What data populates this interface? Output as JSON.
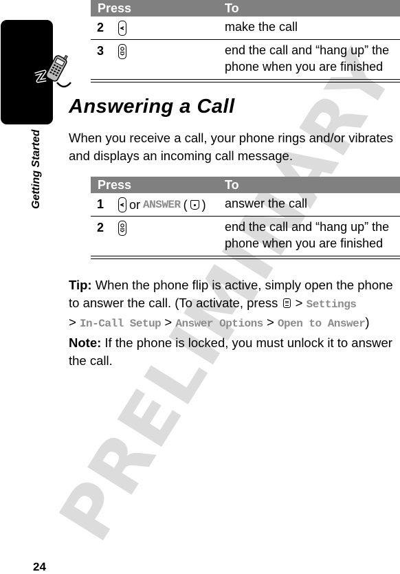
{
  "page": {
    "number": "24",
    "section_label": "Getting Started",
    "watermark": "PRELIMINARY"
  },
  "table_top": {
    "headers": {
      "press": "Press",
      "to": "To"
    },
    "rows": [
      {
        "num": "2",
        "key_icon": "send-key-icon",
        "press_text": "",
        "to": "make the call"
      },
      {
        "num": "3",
        "key_icon": "end-key-icon",
        "press_text": "",
        "to": "end the call and “hang up” the phone when you are finished"
      }
    ]
  },
  "heading": "Answering a Call",
  "intro": "When you receive a call, your phone rings and/or vibrates and displays an incoming call message.",
  "table_answer": {
    "headers": {
      "press": "Press",
      "to": "To"
    },
    "rows": [
      {
        "num": "1",
        "key_icon": "send-key-icon",
        "or_text": "or",
        "softkey_label": "ANSWER",
        "softkey_icon": "center-select-key-icon",
        "to": "answer the call"
      },
      {
        "num": "2",
        "key_icon": "end-key-icon",
        "to": "end the call and “hang up” the phone when you are finished"
      }
    ]
  },
  "tip": {
    "label": "Tip:",
    "text1": "When the phone flip is active, simply open the phone to answer the call. (To activate, press",
    "menu_icon": "menu-key-icon",
    "path": [
      "Settings",
      "In-Call Setup",
      "Answer Options",
      "Open to Answer"
    ],
    "separator": ">",
    "close": ")"
  },
  "note": {
    "label": "Note:",
    "text": "If the phone is locked, you must unlock it to answer the call."
  },
  "colors": {
    "table_header_bg": "#808080",
    "menu_path_text": "#8a8a8a",
    "watermark": "#dcdcdc",
    "side_tab": "#000000"
  }
}
